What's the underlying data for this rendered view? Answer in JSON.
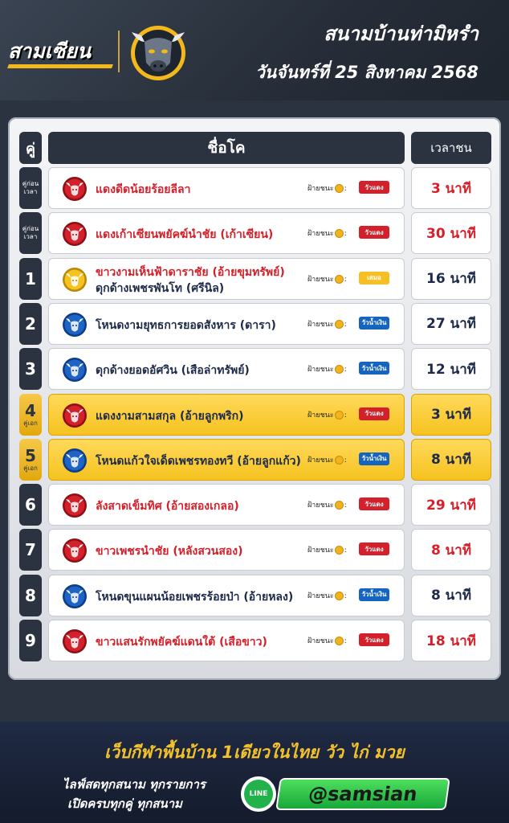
{
  "header": {
    "logo_text": "สามเซียน",
    "title": "สนามบ้านท่ามิหรำ",
    "date": "วันจันทร์ที่ 25  สิงหาคม 2568"
  },
  "table": {
    "col_no": "คู่",
    "col_name": "ชื่อโค",
    "col_time": "เวลาชน",
    "win_label": "ฝ้ายชนะ",
    "rows": [
      {
        "no": "",
        "small": "คู่ก่อนเวลา",
        "name1": "แดงดีดน้อยร้อยลีลา",
        "name2": "",
        "name_color": "red",
        "badge": "red",
        "tag": "วัวแดง",
        "tag_color": "r",
        "time": "3 นาที",
        "time_color": "red",
        "highlight": false
      },
      {
        "no": "",
        "small": "คู่ก่อนเวลา",
        "name1": "แดงเก้าเซียนพยัคฆ์นำชัย (เก้าเซียน)",
        "name2": "",
        "name_color": "red",
        "badge": "red",
        "tag": "วัวแดง",
        "tag_color": "r",
        "time": "30 นาที",
        "time_color": "red",
        "highlight": false
      },
      {
        "no": "1",
        "small": "",
        "name1": "ขาวงามเห็นฟ้าดาราชัย (อ้ายขุมทรัพย์)",
        "name2": "ดุกด้างเพชรพันโท (ศรีนิล)",
        "name_color": "red",
        "badge": "gold",
        "tag": "เสมอ",
        "tag_color": "y",
        "time": "16 นาที",
        "time_color": "navy",
        "highlight": false
      },
      {
        "no": "2",
        "small": "",
        "name1": "โหนดงามยุทธการยอดสังหาร (ดารา)",
        "name2": "",
        "name_color": "navy",
        "badge": "blue",
        "tag": "วัวน้ำเงิน",
        "tag_color": "b",
        "time": "27 นาที",
        "time_color": "navy",
        "highlight": false
      },
      {
        "no": "3",
        "small": "",
        "name1": "ดุกด้างยอดอัศวิน (เสือล่าทรัพย์)",
        "name2": "",
        "name_color": "navy",
        "badge": "blue",
        "tag": "วัวน้ำเงิน",
        "tag_color": "b",
        "time": "12 นาที",
        "time_color": "navy",
        "highlight": false
      },
      {
        "no": "4",
        "small": "คู่เอก",
        "name1": "แดงงามสามสกุล (อ้ายลูกพริก)",
        "name2": "",
        "name_color": "navy",
        "badge": "red",
        "tag": "วัวแดง",
        "tag_color": "r",
        "time": "3 นาที",
        "time_color": "navy",
        "highlight": true
      },
      {
        "no": "5",
        "small": "คู่เอก",
        "name1": "โหนดแก้วใจเด็ดเพชรทองทวี (อ้ายลูกแก้ว)",
        "name2": "",
        "name_color": "navy",
        "badge": "blue",
        "tag": "วัวน้ำเงิน",
        "tag_color": "b",
        "time": "8 นาที",
        "time_color": "navy",
        "highlight": true
      },
      {
        "no": "6",
        "small": "",
        "name1": "ลังสาดเข็มทิศ (อ้ายสองเกลอ)",
        "name2": "",
        "name_color": "red",
        "badge": "red",
        "tag": "วัวแดง",
        "tag_color": "r",
        "time": "29 นาที",
        "time_color": "red",
        "highlight": false
      },
      {
        "no": "7",
        "small": "",
        "name1": "ขาวเพชรนำชัย (หลังสวนสอง)",
        "name2": "",
        "name_color": "red",
        "badge": "red",
        "tag": "วัวแดง",
        "tag_color": "r",
        "time": "8 นาที",
        "time_color": "red",
        "highlight": false
      },
      {
        "no": "8",
        "small": "",
        "name1": "โหนดขุนแผนน้อยเพชรร้อยป่า (อ้ายหลง)",
        "name2": "",
        "name_color": "navy",
        "badge": "blue",
        "tag": "วัวน้ำเงิน",
        "tag_color": "b",
        "time": "8 นาที",
        "time_color": "navy",
        "highlight": false
      },
      {
        "no": "9",
        "small": "",
        "name1": "ขาวแสนรักพยัคฆ์แดนใต้ (เสือขาว)",
        "name2": "",
        "name_color": "red",
        "badge": "red",
        "tag": "วัวแดง",
        "tag_color": "r",
        "time": "18 นาที",
        "time_color": "red",
        "highlight": false
      }
    ]
  },
  "footer": {
    "slogan": "เว็บกีฬาพื้นบ้าน 1เดียวในไทย  วัว  ไก่  มวย",
    "line1": "ไลฟ์สดทุกสนาม ทุกรายการ",
    "line2": "เปิดครบทุกคู่ ทุกสนาม",
    "line_icon_text": "LINE",
    "handle": "@samsian"
  },
  "colors": {
    "red": "#d4202a",
    "navy": "#1e2a4a",
    "gold": "#f5c21f",
    "blue_tag": "#1565c0",
    "dark": "#2b3340"
  },
  "icons": [
    "bull-head-logo-icon",
    "bull-badge-red-icon",
    "bull-badge-blue-icon",
    "bull-badge-gold-icon",
    "coin-icon",
    "line-app-icon"
  ]
}
